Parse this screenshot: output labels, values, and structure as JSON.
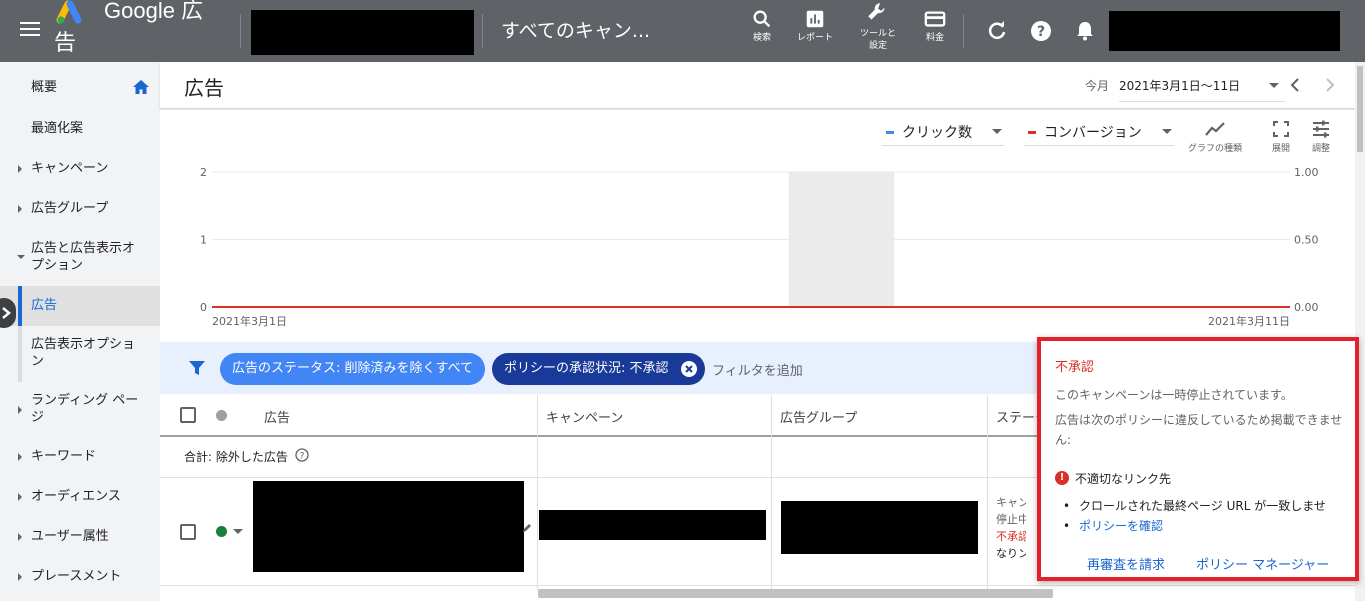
{
  "topbar": {
    "brand_line1": "Google 広",
    "brand_line2": "告",
    "campaign_title": "すべてのキャン...",
    "tools": [
      {
        "label": "検索"
      },
      {
        "label": "レポート"
      },
      {
        "label_line1": "ツールと",
        "label_line2": "設定"
      },
      {
        "label": "料金"
      }
    ]
  },
  "sidebar": {
    "items": [
      {
        "label": "概要"
      },
      {
        "label": "最適化案"
      },
      {
        "label": "キャンペーン"
      },
      {
        "label": "広告グループ"
      },
      {
        "label": "広告と広告表示オプション"
      },
      {
        "label": "広告"
      },
      {
        "label": "広告表示オプション"
      },
      {
        "label": "ランディング ページ"
      },
      {
        "label": "キーワード"
      },
      {
        "label": "オーディエンス"
      },
      {
        "label": "ユーザー属性"
      },
      {
        "label": "プレースメント"
      }
    ]
  },
  "header": {
    "title": "広告",
    "date_label": "今月",
    "date_range": "2021年3月1日～11日"
  },
  "chart_tools": {
    "metric1": "クリック数",
    "metric2": "コンバージョン",
    "graph_type": "グラフの種類",
    "expand": "展開",
    "adjust": "調整"
  },
  "chart_data": {
    "type": "line",
    "x_start_label": "2021年3月1日",
    "x_end_label": "2021年3月11日",
    "left_ticks": [
      "2",
      "1",
      "0"
    ],
    "right_ticks": [
      "1.00",
      "0.50",
      "0.00"
    ],
    "ylim_left": [
      0,
      2
    ],
    "ylim_right": [
      0,
      1
    ],
    "series": [
      {
        "name": "クリック数",
        "color": "#4285f4",
        "values": [
          0,
          0,
          0,
          0,
          0,
          0,
          0,
          0,
          0,
          0,
          0
        ]
      },
      {
        "name": "コンバージョン",
        "color": "#d93025",
        "values": [
          0,
          0,
          0,
          0,
          0,
          0,
          0,
          0,
          0,
          0,
          0
        ]
      }
    ]
  },
  "filters": {
    "chip1": "広告のステータス: 削除済みを除くすべて",
    "chip2": "ポリシーの承認状況: 不承認",
    "add_filter": "フィルタを追加"
  },
  "table": {
    "headers": [
      "広告",
      "キャンペーン",
      "広告グループ",
      "ステータス"
    ],
    "total_row": "合計: 除外した広告",
    "status_lines": [
      "キャンペーン",
      "停止中",
      "不承認:",
      "なりンク"
    ]
  },
  "popup": {
    "title": "不承認",
    "line1": "このキャンペーンは一時停止されています。",
    "line2": "広告は次のポリシーに違反しているため掲載できません:",
    "violation": "不適切なリンク先",
    "bullet1": "クロールされた最終ページ URL が一致しませ",
    "bullet2": "ポリシーを確認",
    "action1": "再審査を請求",
    "action2": "ポリシー マネージャー"
  },
  "colors": {
    "topbar": "#5f6368",
    "accent": "#1967d2",
    "error": "#d93025",
    "chip_light": "#4285f4",
    "chip_dark": "#1a3a9a"
  }
}
